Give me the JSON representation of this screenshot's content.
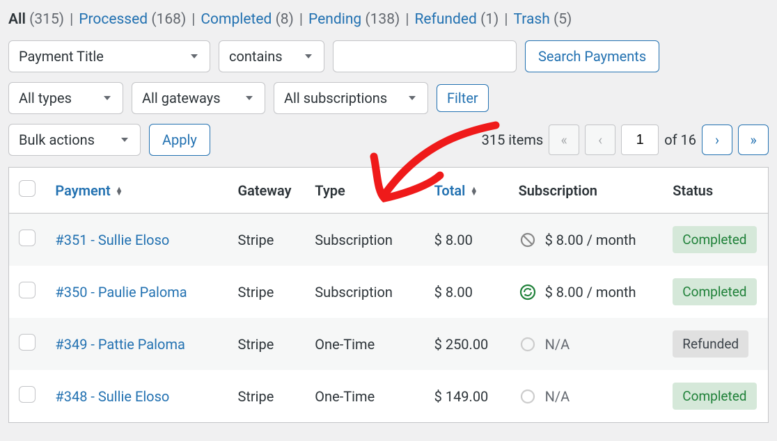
{
  "status_links": [
    {
      "label": "All",
      "count": "(315)",
      "current": true
    },
    {
      "label": "Processed",
      "count": "(168)",
      "current": false
    },
    {
      "label": "Completed",
      "count": "(8)",
      "current": false
    },
    {
      "label": "Pending",
      "count": "(138)",
      "current": false
    },
    {
      "label": "Refunded",
      "count": "(1)",
      "current": false
    },
    {
      "label": "Trash",
      "count": "(5)",
      "current": false
    }
  ],
  "search": {
    "field": "Payment Title",
    "operator": "contains",
    "value": "",
    "button": "Search Payments"
  },
  "filters": {
    "type": "All types",
    "gateway": "All gateways",
    "subscription": "All subscriptions",
    "button": "Filter"
  },
  "bulk": {
    "label": "Bulk actions",
    "apply": "Apply"
  },
  "pager": {
    "items_text": "315 items",
    "page": "1",
    "of_text": "of 16",
    "prev_all": "«",
    "prev": "‹",
    "next": "›",
    "next_all": "»"
  },
  "columns": {
    "payment": "Payment",
    "gateway": "Gateway",
    "type": "Type",
    "total": "Total",
    "subscription": "Subscription",
    "status": "Status"
  },
  "rows": [
    {
      "payment": "#351 - Sullie Eloso",
      "gateway": "Stripe",
      "type": "Subscription",
      "total": "$ 8.00",
      "sub_icon": "cancelled",
      "sub": "$ 8.00 / month",
      "status": "Completed",
      "status_kind": "completed"
    },
    {
      "payment": "#350 - Paulie Paloma",
      "gateway": "Stripe",
      "type": "Subscription",
      "total": "$ 8.00",
      "sub_icon": "active",
      "sub": "$ 8.00 / month",
      "status": "Completed",
      "status_kind": "completed"
    },
    {
      "payment": "#349 - Pattie Paloma",
      "gateway": "Stripe",
      "type": "One-Time",
      "total": "$ 250.00",
      "sub_icon": "none",
      "sub": "N/A",
      "status": "Refunded",
      "status_kind": "refunded"
    },
    {
      "payment": "#348 - Sullie Eloso",
      "gateway": "Stripe",
      "type": "One-Time",
      "total": "$ 149.00",
      "sub_icon": "none",
      "sub": "N/A",
      "status": "Completed",
      "status_kind": "completed"
    }
  ]
}
